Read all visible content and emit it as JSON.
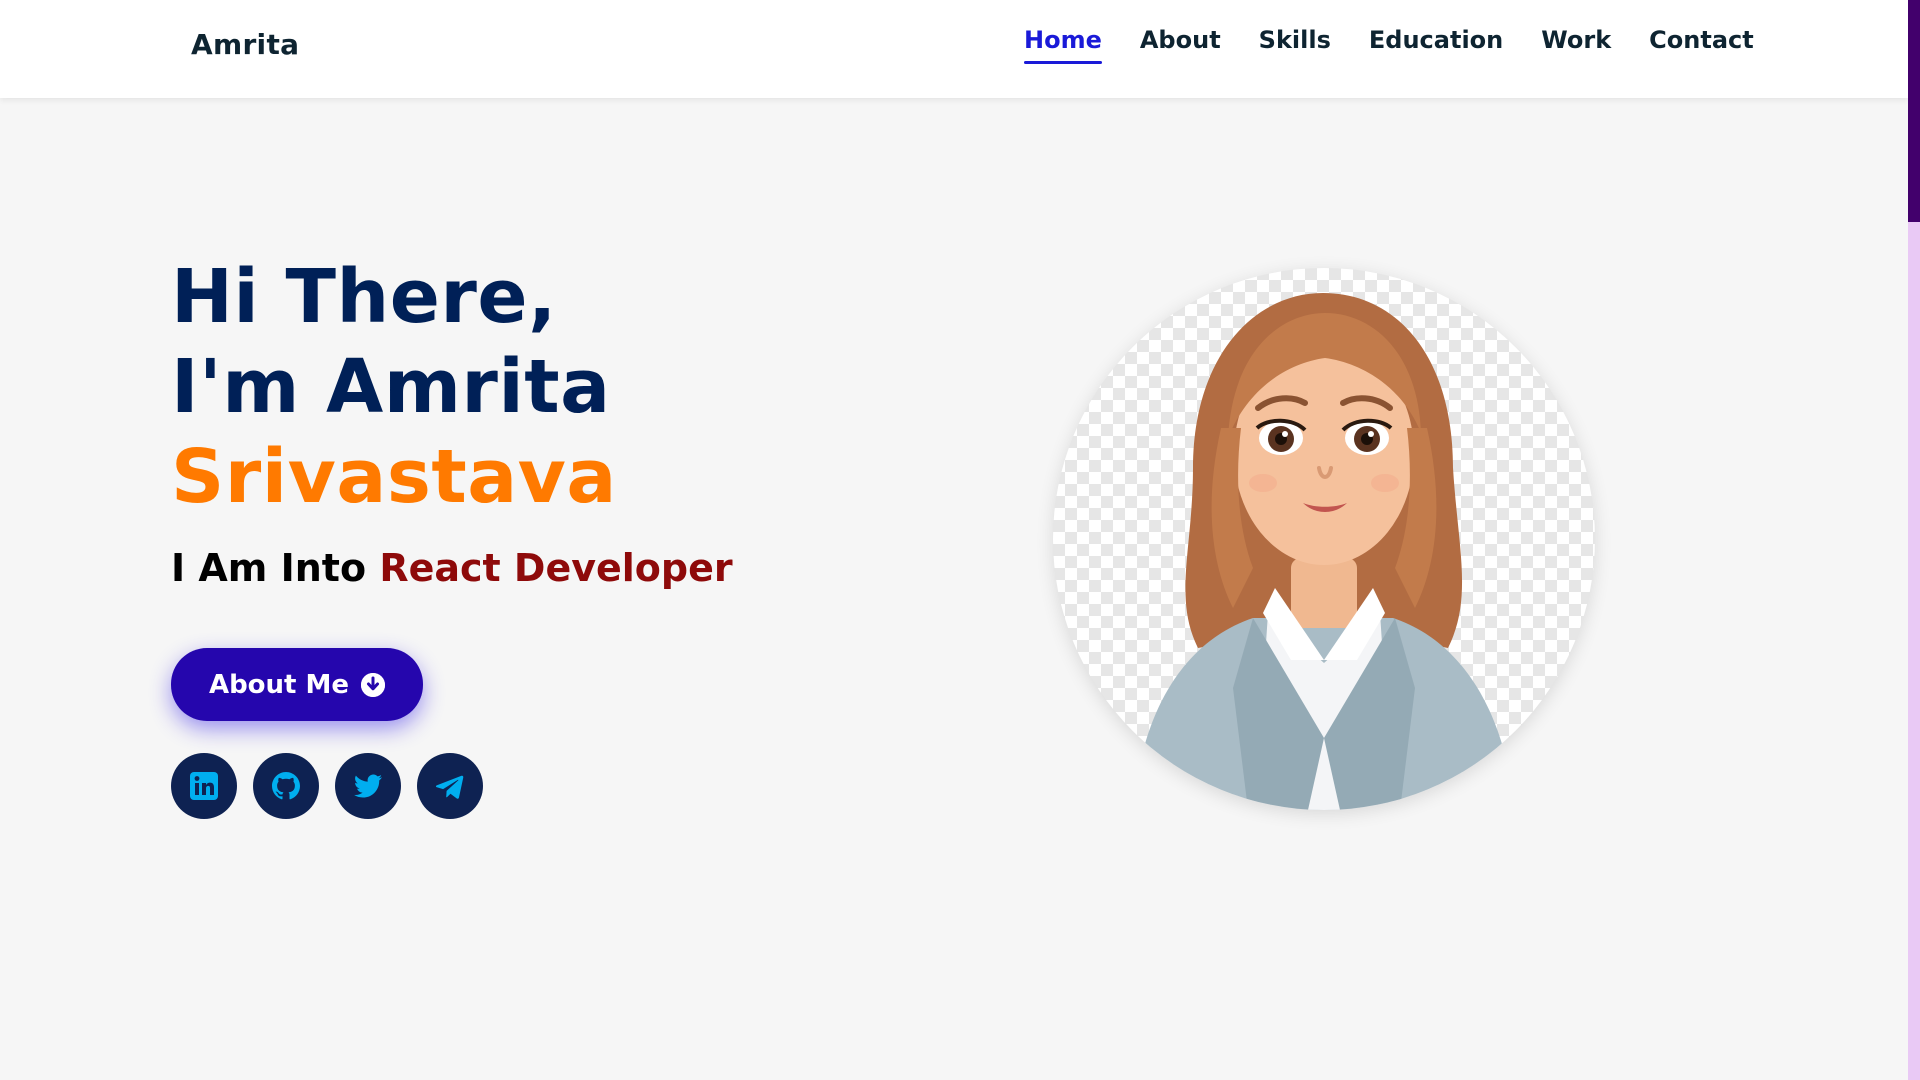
{
  "header": {
    "logo": "Amrita",
    "nav": [
      {
        "label": "Home",
        "active": true
      },
      {
        "label": "About",
        "active": false
      },
      {
        "label": "Skills",
        "active": false
      },
      {
        "label": "Education",
        "active": false
      },
      {
        "label": "Work",
        "active": false
      },
      {
        "label": "Contact",
        "active": false
      }
    ]
  },
  "hero": {
    "greeting": "Hi There,",
    "intro": "I'm Amrita",
    "surname": "Srivastava",
    "tagline_prefix": "I Am Into",
    "tagline_role": "React Developer",
    "button_label": "About Me",
    "button_icon": "arrow-circle-down-icon"
  },
  "socials": [
    {
      "name": "linkedin-icon"
    },
    {
      "name": "github-icon"
    },
    {
      "name": "twitter-icon"
    },
    {
      "name": "telegram-icon"
    }
  ],
  "colors": {
    "title": "#002057",
    "accent": "#ff7a00",
    "role": "#8e0a0a",
    "button": "#2506ad",
    "nav_active": "#1a1ad8",
    "social_bg": "#0e2252",
    "social_icon": "#00aeef",
    "scrollbar_thumb": "#42006c",
    "scrollbar_track": "#e9c9f5"
  },
  "avatar": {
    "alt": "cartoon avatar",
    "icon": "avatar-illustration"
  }
}
